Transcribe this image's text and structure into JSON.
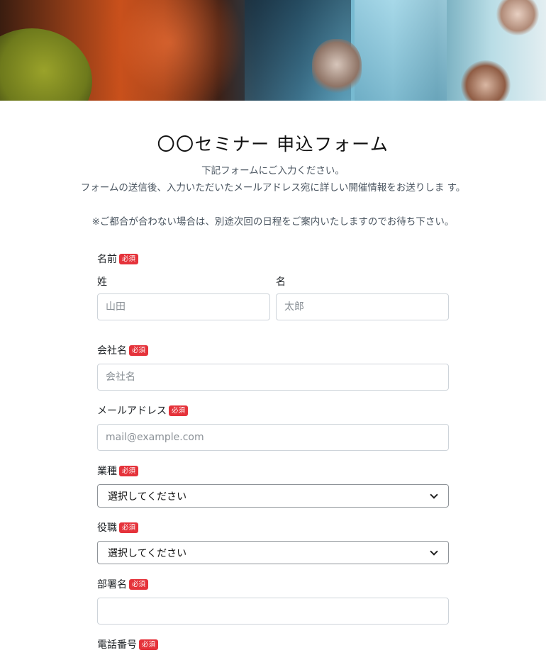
{
  "hero": {
    "image": "webinar-video-call-banner"
  },
  "form": {
    "title": "〇〇セミナー 申込フォーム",
    "description": [
      "下記フォームにご入力ください。",
      "フォームの送信後、入力いただいたメールアドレス宛に詳しい開催情報をお送りしま す。",
      "※ご都合が合わない場合は、別途次回の日程をご案内いたしますのでお待ち下さい。"
    ],
    "required_badge": "必須",
    "fields": {
      "name": {
        "label": "名前",
        "last_label": "姓",
        "first_label": "名",
        "last_placeholder": "山田",
        "first_placeholder": "太郎"
      },
      "company": {
        "label": "会社名",
        "placeholder": "会社名"
      },
      "email": {
        "label": "メールアドレス",
        "placeholder": "mail@example.com"
      },
      "industry": {
        "label": "業種",
        "selected": "選択してください"
      },
      "position": {
        "label": "役職",
        "selected": "選択してください"
      },
      "department": {
        "label": "部署名",
        "value": ""
      },
      "phone": {
        "label": "電話番号"
      }
    }
  },
  "colors": {
    "badge": "#e5333b",
    "input_border": "#ced4da"
  }
}
